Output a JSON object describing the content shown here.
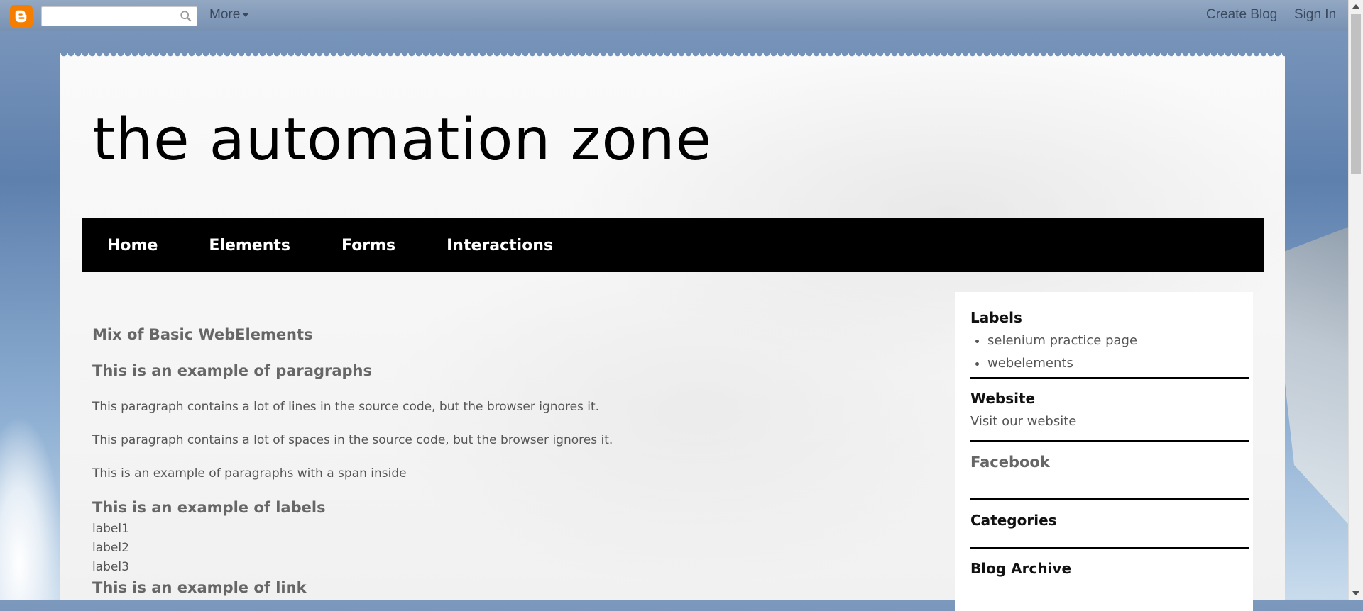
{
  "navbar": {
    "search": {
      "value": "",
      "placeholder": ""
    },
    "more_label": "More",
    "create_blog_label": "Create Blog",
    "sign_in_label": "Sign In"
  },
  "blog": {
    "title": "the automation zone",
    "tabs": [
      {
        "label": "Home"
      },
      {
        "label": "Elements"
      },
      {
        "label": "Forms"
      },
      {
        "label": "Interactions"
      }
    ]
  },
  "main": {
    "heading_mix": "Mix of Basic WebElements",
    "heading_paragraphs": "This is an example of paragraphs",
    "paragraph_1": "This paragraph contains a lot of lines in the source code, but the browser ignores it.",
    "paragraph_2": "This paragraph contains a lot of spaces in the source code, but the browser ignores it.",
    "paragraph_3": "This is an example of paragraphs with a span inside",
    "heading_labels": "This is an example of labels",
    "labels": [
      "label1",
      "label2",
      "label3"
    ],
    "heading_link": "This is an example of link"
  },
  "sidebar": {
    "labels_title": "Labels",
    "labels_items": [
      "selenium practice page",
      "webelements"
    ],
    "website_title": "Website",
    "website_link": "Visit our website",
    "facebook_title": "Facebook",
    "categories_title": "Categories",
    "archive_title": "Blog Archive"
  },
  "colors": {
    "accent": "#f57d00",
    "tab_bar": "#000000",
    "tab_text": "#ffffff"
  }
}
